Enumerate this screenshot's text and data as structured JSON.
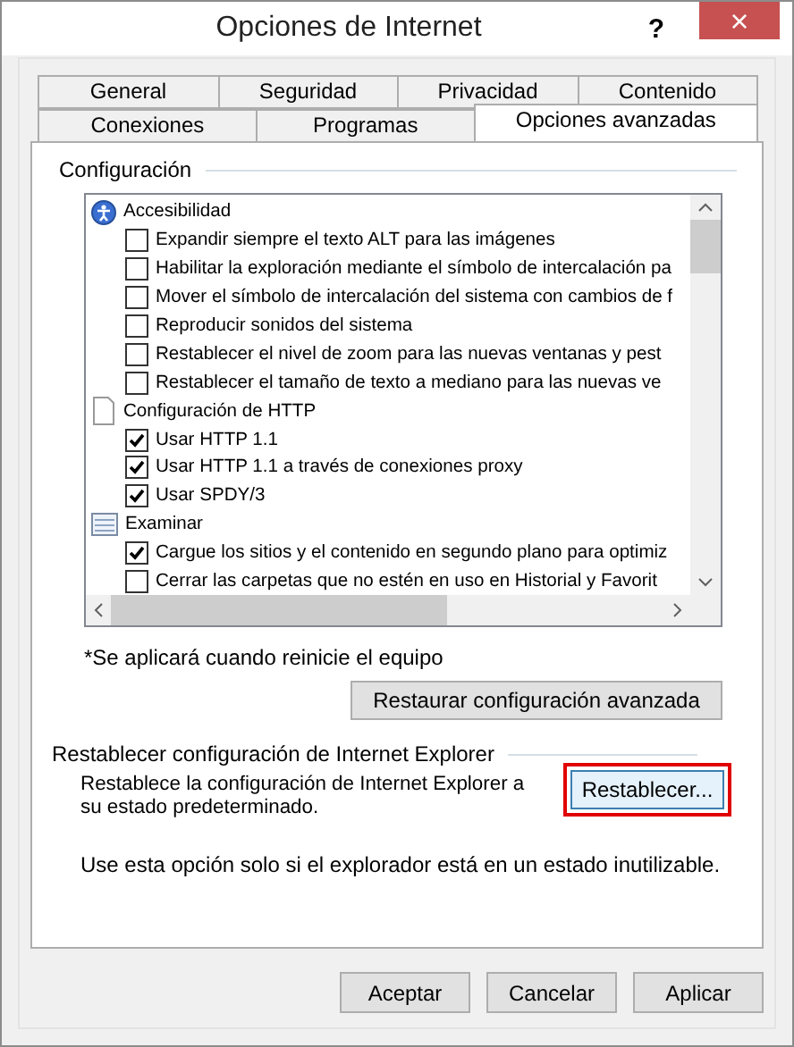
{
  "window": {
    "title": "Opciones de Internet",
    "help": "?",
    "close": "×"
  },
  "tab_rows": [
    [
      {
        "label": "General",
        "selected": false
      },
      {
        "label": "Seguridad",
        "selected": false
      },
      {
        "label": "Privacidad",
        "selected": false
      },
      {
        "label": "Contenido",
        "selected": false
      }
    ],
    [
      {
        "label": "Conexiones",
        "selected": false
      },
      {
        "label": "Programas",
        "selected": false
      },
      {
        "label": "Opciones avanzadas",
        "selected": true
      }
    ]
  ],
  "settings": {
    "title": "Configuración",
    "groups": [
      {
        "label": "Accesibilidad",
        "children": [
          {
            "label": "Expandir siempre el texto ALT para las imágenes",
            "checked": false
          },
          {
            "label": "Habilitar la exploración mediante el símbolo de intercalación pa",
            "checked": false
          },
          {
            "label": "Mover el símbolo de intercalación del sistema con cambios de f",
            "checked": false
          },
          {
            "label": "Reproducir sonidos del sistema",
            "checked": false
          },
          {
            "label": "Restablecer el nivel de zoom para las nuevas ventanas y pest",
            "checked": false
          },
          {
            "label": "Restablecer el tamaño de texto a mediano para las nuevas ve",
            "checked": false
          }
        ]
      },
      {
        "label": "Configuración de HTTP",
        "children": [
          {
            "label": "Usar HTTP 1.1",
            "checked": true
          },
          {
            "label": "Usar HTTP 1.1 a través de conexiones proxy",
            "checked": true
          },
          {
            "label": "Usar SPDY/3",
            "checked": true
          }
        ]
      },
      {
        "label": "Examinar",
        "children": [
          {
            "label": "Cargue los sitios y el contenido en segundo plano para optimiz",
            "checked": true
          },
          {
            "label": "Cerrar las carpetas que no estén en uso en Historial y Favorit",
            "checked": false
          }
        ]
      }
    ],
    "note": "*Se aplicará cuando reinicie el equipo",
    "restore_button": "Restaurar configuración avanzada"
  },
  "reset": {
    "title": "Restablecer configuración de Internet Explorer",
    "description": "Restablece la configuración de Internet Explorer a su estado predeterminado.",
    "button": {
      "label": "Restablecer...",
      "highlighted": true
    },
    "hint": "Use esta opción solo si el explorador está en un estado inutilizable."
  },
  "buttons": [
    "Aceptar",
    "Cancelar",
    "Aplicar"
  ]
}
